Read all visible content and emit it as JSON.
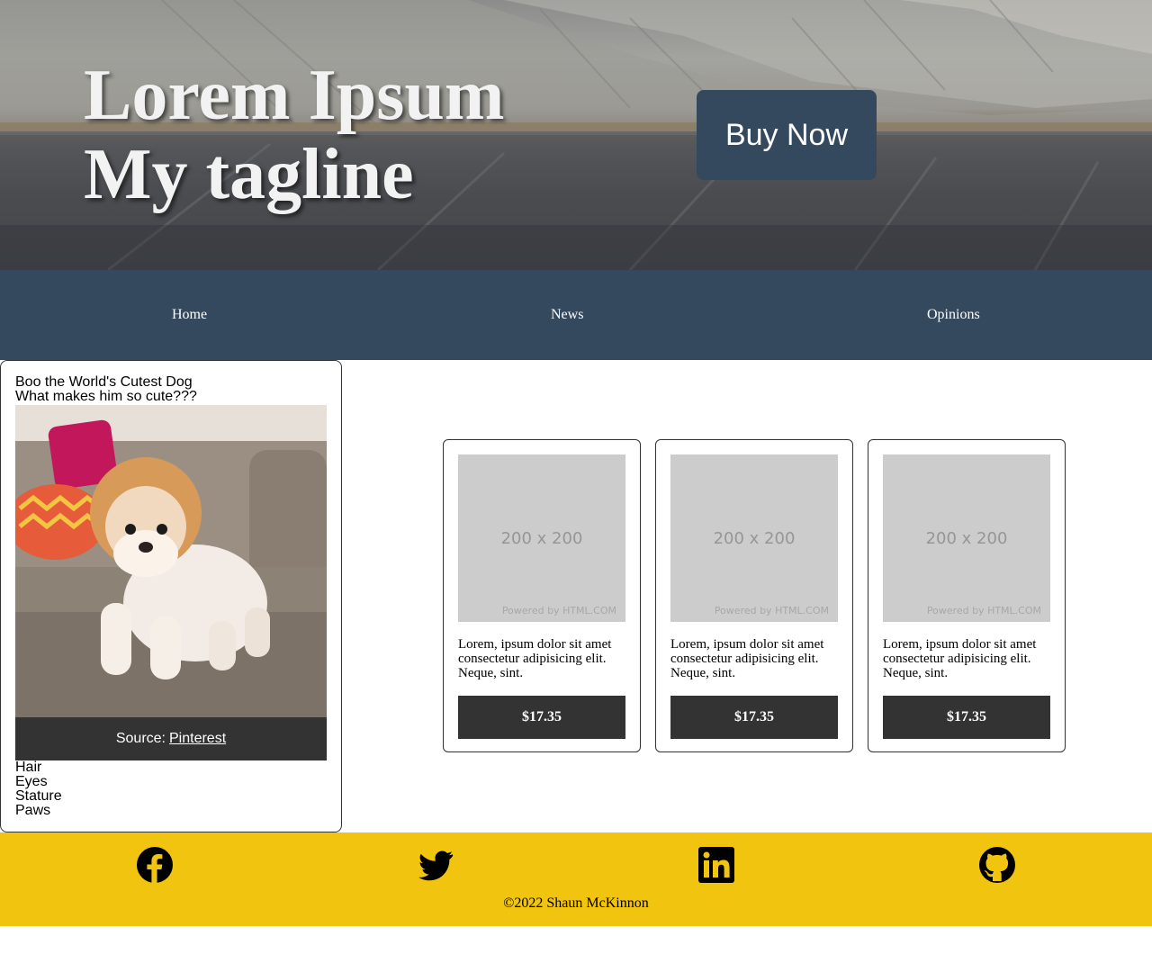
{
  "hero": {
    "title_line1": "Lorem Ipsum",
    "title_line2": "My tagline",
    "cta_label": "Buy Now"
  },
  "nav": {
    "items": [
      {
        "label": "Home"
      },
      {
        "label": "News"
      },
      {
        "label": "Opinions"
      }
    ]
  },
  "aside": {
    "heading": "Boo the World's Cutest Dog",
    "subheading": "What makes him so cute???",
    "image_alt": "Pomeranian puppy standing on a sofa",
    "caption_prefix": "Source:",
    "caption_link": "Pinterest",
    "traits": [
      "Hair",
      "Eyes",
      "Stature",
      "Paws"
    ]
  },
  "products": [
    {
      "placeholder_size": "200 x 200",
      "placeholder_credit": "Powered by HTML.COM",
      "description": "Lorem, ipsum dolor sit amet consectetur adipisicing elit. Neque, sint.",
      "price": "$17.35"
    },
    {
      "placeholder_size": "200 x 200",
      "placeholder_credit": "Powered by HTML.COM",
      "description": "Lorem, ipsum dolor sit amet consectetur adipisicing elit. Neque, sint.",
      "price": "$17.35"
    },
    {
      "placeholder_size": "200 x 200",
      "placeholder_credit": "Powered by HTML.COM",
      "description": "Lorem, ipsum dolor sit amet consectetur adipisicing elit. Neque, sint.",
      "price": "$17.35"
    }
  ],
  "footer": {
    "social_icons": [
      "facebook-icon",
      "twitter-icon",
      "linkedin-icon",
      "github-icon"
    ],
    "copyright": "©2022 Shaun McKinnon"
  },
  "colors": {
    "nav_bg": "#34495e",
    "footer_bg": "#f1c40f",
    "button_dark": "#333333",
    "placeholder": "#cccccc"
  }
}
